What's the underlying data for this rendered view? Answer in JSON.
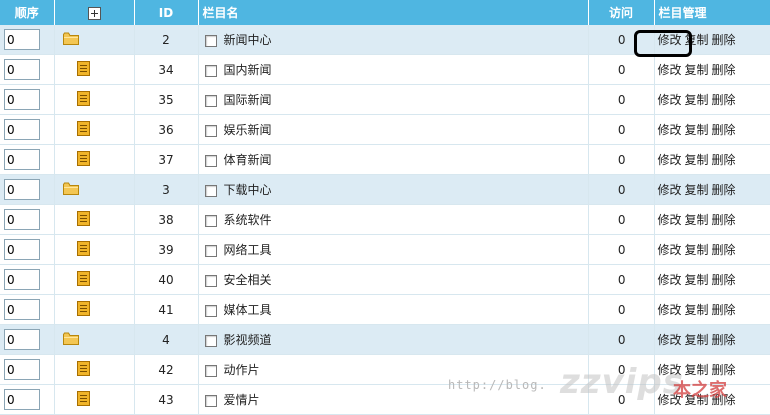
{
  "header": {
    "order": "顺序",
    "id": "ID",
    "name": "栏目名",
    "visit": "访问",
    "manage": "栏目管理"
  },
  "actions": {
    "edit": "修改",
    "copy": "复制",
    "delete": "删除"
  },
  "rows": [
    {
      "level": "parent",
      "order": "0",
      "id": "2",
      "name": "新闻中心",
      "visit": "0",
      "icon": "folder-icon"
    },
    {
      "level": "child",
      "order": "0",
      "id": "34",
      "name": "国内新闻",
      "visit": "0",
      "icon": "document-icon"
    },
    {
      "level": "child",
      "order": "0",
      "id": "35",
      "name": "国际新闻",
      "visit": "0",
      "icon": "document-icon"
    },
    {
      "level": "child",
      "order": "0",
      "id": "36",
      "name": "娱乐新闻",
      "visit": "0",
      "icon": "document-icon"
    },
    {
      "level": "child",
      "order": "0",
      "id": "37",
      "name": "体育新闻",
      "visit": "0",
      "icon": "document-icon"
    },
    {
      "level": "parent",
      "order": "0",
      "id": "3",
      "name": "下载中心",
      "visit": "0",
      "icon": "folder-icon"
    },
    {
      "level": "child",
      "order": "0",
      "id": "38",
      "name": "系统软件",
      "visit": "0",
      "icon": "document-icon"
    },
    {
      "level": "child",
      "order": "0",
      "id": "39",
      "name": "网络工具",
      "visit": "0",
      "icon": "document-icon"
    },
    {
      "level": "child",
      "order": "0",
      "id": "40",
      "name": "安全相关",
      "visit": "0",
      "icon": "document-icon"
    },
    {
      "level": "child",
      "order": "0",
      "id": "41",
      "name": "媒体工具",
      "visit": "0",
      "icon": "document-icon"
    },
    {
      "level": "parent",
      "order": "0",
      "id": "4",
      "name": "影视频道",
      "visit": "0",
      "icon": "folder-icon"
    },
    {
      "level": "child",
      "order": "0",
      "id": "42",
      "name": "动作片",
      "visit": "0",
      "icon": "document-icon"
    },
    {
      "level": "child",
      "order": "0",
      "id": "43",
      "name": "爱情片",
      "visit": "0",
      "icon": "document-icon"
    }
  ],
  "watermark": {
    "url": "http://blog.",
    "logo": "zzvips",
    "suffix": "本之家"
  },
  "colors": {
    "header_bg": "#4fb6e1",
    "parent_row_bg": "#dcebf4",
    "folder": "#f3c653",
    "document": "#f0b429"
  }
}
